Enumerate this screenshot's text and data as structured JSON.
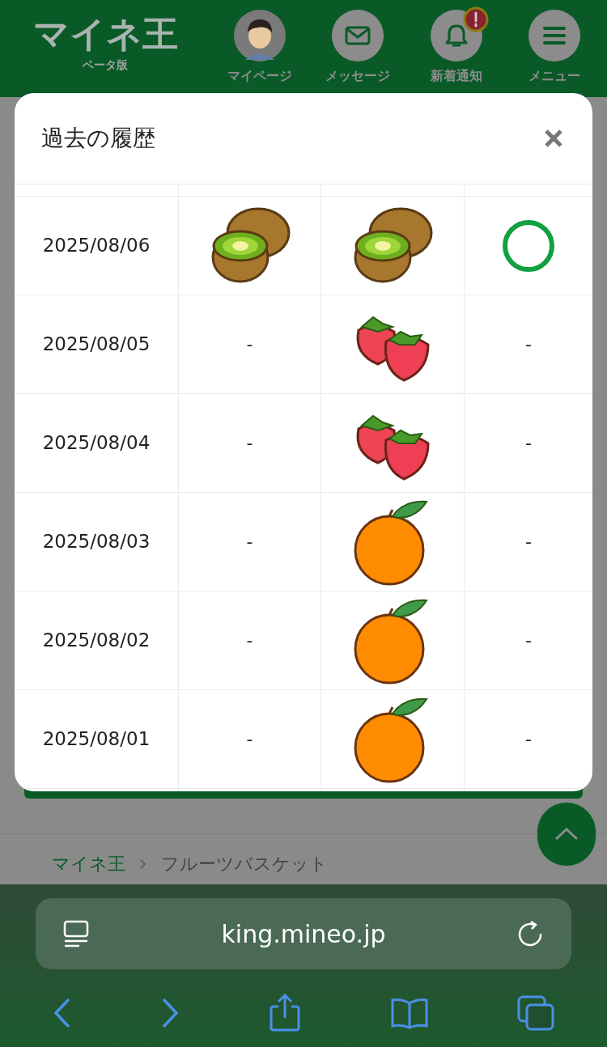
{
  "header": {
    "logo": "マイネ王",
    "logo_sub": "ベータ版",
    "nav": [
      {
        "label": "マイページ",
        "kind": "avatar",
        "badge": false
      },
      {
        "label": "メッセージ",
        "kind": "mail",
        "badge": false
      },
      {
        "label": "新着通知",
        "kind": "bell",
        "badge": true
      },
      {
        "label": "メニュー",
        "kind": "menu",
        "badge": false
      }
    ]
  },
  "modal": {
    "title": "過去の履歴",
    "rows": [
      {
        "date": "2025/08/06",
        "cells": [
          {
            "kind": "kiwi"
          },
          {
            "kind": "kiwi"
          },
          {
            "kind": "circle"
          }
        ]
      },
      {
        "date": "2025/08/05",
        "cells": [
          {
            "kind": "dash",
            "text": "-"
          },
          {
            "kind": "strawberry"
          },
          {
            "kind": "dash",
            "text": "-"
          }
        ]
      },
      {
        "date": "2025/08/04",
        "cells": [
          {
            "kind": "dash",
            "text": "-"
          },
          {
            "kind": "strawberry"
          },
          {
            "kind": "dash",
            "text": "-"
          }
        ]
      },
      {
        "date": "2025/08/03",
        "cells": [
          {
            "kind": "dash",
            "text": "-"
          },
          {
            "kind": "orange"
          },
          {
            "kind": "dash",
            "text": "-"
          }
        ]
      },
      {
        "date": "2025/08/02",
        "cells": [
          {
            "kind": "dash",
            "text": "-"
          },
          {
            "kind": "orange"
          },
          {
            "kind": "dash",
            "text": "-"
          }
        ]
      },
      {
        "date": "2025/08/01",
        "cells": [
          {
            "kind": "dash",
            "text": "-"
          },
          {
            "kind": "orange"
          },
          {
            "kind": "dash",
            "text": "-"
          }
        ]
      }
    ]
  },
  "breadcrumb": [
    {
      "label": "マイネ王",
      "kind": "link"
    },
    {
      "label": "フルーツバスケット",
      "kind": "current"
    }
  ],
  "browser": {
    "url": "king.mineo.jp"
  }
}
